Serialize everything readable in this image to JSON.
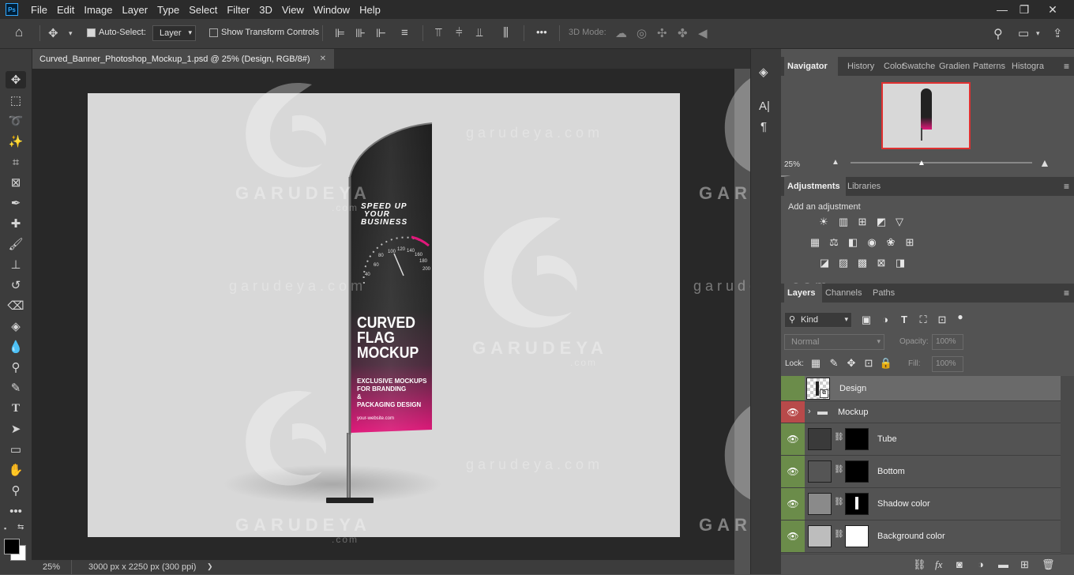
{
  "app": {
    "logo": "Ps"
  },
  "menu": [
    "File",
    "Edit",
    "Image",
    "Layer",
    "Type",
    "Select",
    "Filter",
    "3D",
    "View",
    "Window",
    "Help"
  ],
  "window_controls": {
    "minimize": "—",
    "restore": "❐",
    "close": "✕"
  },
  "options_bar": {
    "auto_select_label": "Auto-Select:",
    "auto_select_target": "Layer",
    "transform_label": "Show Transform Controls",
    "mode_3d_label": "3D Mode:",
    "more": "•••"
  },
  "document_tab": {
    "title": "Curved_Banner_Photoshop_Mockup_1.psd @ 25% (Design, RGB/8#)",
    "close": "✕"
  },
  "status_bar": {
    "zoom": "25%",
    "dimensions": "3000 px x 2250 px (300 ppi)",
    "arrow": "❯"
  },
  "tools": [
    "move-tool",
    "marquee-tool",
    "lasso-tool",
    "magic-wand-tool",
    "crop-tool",
    "frame-tool",
    "eyedropper-tool",
    "healing-tool",
    "brush-tool",
    "stamp-tool",
    "history-brush-tool",
    "eraser-tool",
    "paint-bucket-tool",
    "blur-tool",
    "dodge-tool",
    "pen-tool",
    "type-tool",
    "path-select-tool",
    "rectangle-tool",
    "hand-tool",
    "zoom-tool",
    "more-tools"
  ],
  "flag": {
    "headline": [
      "SPEED UP",
      "YOUR",
      "BUSINESS"
    ],
    "gauge_labels": [
      "40",
      "60",
      "80",
      "100",
      "120",
      "140",
      "160",
      "180",
      "200"
    ],
    "title": [
      "CURVED",
      "FLAG",
      "MOCKUP"
    ],
    "subtitle": [
      "EXCLUSIVE MOCKUPS",
      "FOR BRANDING",
      "&",
      "PACKAGING DESIGN"
    ],
    "website": "your-website.com"
  },
  "watermarks": {
    "brand_upper": "GARUDEYA",
    "brand_lower": "garudeya.com",
    "suffix": ".com"
  },
  "navigator": {
    "tabs": [
      "Navigator",
      "History",
      "Color",
      "Swatche",
      "Gradien",
      "Patterns",
      "Histogra"
    ],
    "zoom": "25%"
  },
  "adjustments": {
    "tabs": [
      "Adjustments",
      "Libraries"
    ],
    "hint": "Add an adjustment"
  },
  "layers_panel": {
    "tabs": [
      "Layers",
      "Channels",
      "Paths"
    ],
    "kind_filter": "Kind",
    "blend_mode": "Normal",
    "opacity_label": "Opacity:",
    "opacity_value": "100%",
    "lock_label": "Lock:",
    "fill_label": "Fill:",
    "fill_value": "100%",
    "layers": [
      {
        "name": "Design",
        "type": "smart-object",
        "visible": false,
        "selected": true
      },
      {
        "name": "Mockup",
        "type": "group",
        "visible": true
      },
      {
        "name": "Tube",
        "type": "adjustment",
        "visible": true
      },
      {
        "name": "Bottom",
        "type": "adjustment",
        "visible": true
      },
      {
        "name": "Shadow color",
        "type": "adjustment",
        "visible": true
      },
      {
        "name": "Background color",
        "type": "adjustment",
        "visible": true
      }
    ],
    "bottom_bar": [
      "link-icon",
      "fx-icon",
      "mask-icon",
      "adjustment-icon",
      "folder-icon",
      "new-layer-icon",
      "trash-icon"
    ]
  },
  "colors": {
    "menubar": "#2b2b2b",
    "panel": "#535353",
    "canvas_bg": "#d8d8d8",
    "flag_top": "#1f1f1f",
    "flag_bottom": "#e0187a",
    "eye_green": "#6b8c4a",
    "eye_red": "#b84a4a",
    "nav_frame": "#e03030"
  }
}
